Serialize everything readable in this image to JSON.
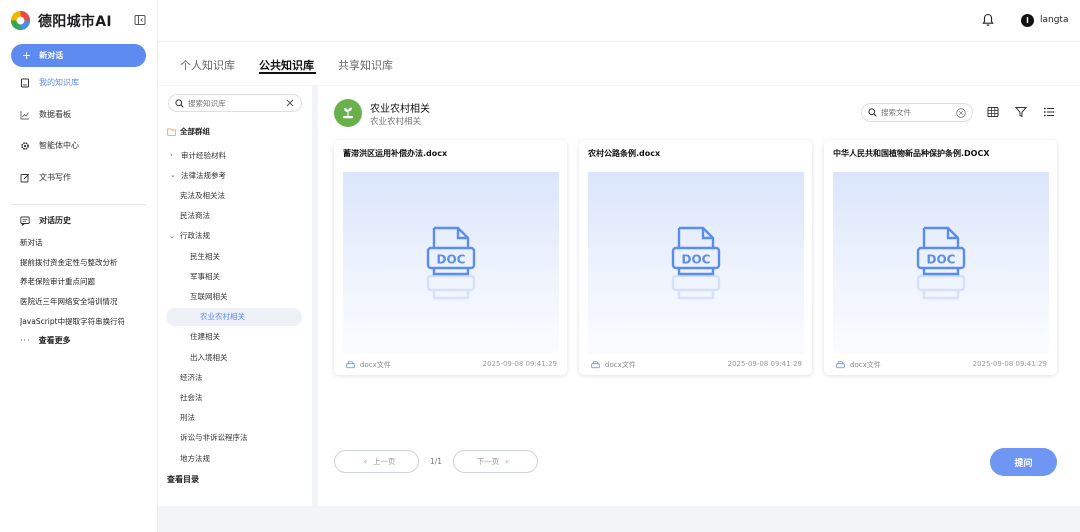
{
  "app": {
    "title": "德阳城市AI"
  },
  "sidebar": {
    "new_chat_label": "新对话",
    "nav": [
      {
        "label": "我的知识库",
        "icon": "book-icon",
        "active": true
      },
      {
        "label": "数据看板",
        "icon": "chart-icon",
        "active": false
      },
      {
        "label": "智能体中心",
        "icon": "gear-icon",
        "active": false
      },
      {
        "label": "文书写作",
        "icon": "edit-icon",
        "active": false
      }
    ],
    "history_title": "对话历史",
    "history": [
      "新对话",
      "提前拨付资金定性与整改分析",
      "养老保险审计重点问题",
      "医院近三年网络安全培训情况",
      "JavaScript中提取字符串换行符"
    ],
    "see_more": "查看更多"
  },
  "topbar": {
    "username": "langta",
    "avatar_initial": "l"
  },
  "tabs": [
    {
      "label": "个人知识库",
      "active": false
    },
    {
      "label": "公共知识库",
      "active": true
    },
    {
      "label": "共享知识库",
      "active": false
    }
  ],
  "tree": {
    "search_placeholder": "搜索知识库",
    "root_label": "全部群组",
    "rows": [
      {
        "label": "审计经验材料",
        "depth": 0,
        "arrow": "›"
      },
      {
        "label": "法律法规参考",
        "depth": 0,
        "arrow": "⌄"
      },
      {
        "label": "宪法及相关法",
        "depth": 1,
        "arrow": ""
      },
      {
        "label": "民法商法",
        "depth": 1,
        "arrow": ""
      },
      {
        "label": "行政法规",
        "depth": 1,
        "arrow": "⌄"
      },
      {
        "label": "民生相关",
        "depth": 2,
        "arrow": ""
      },
      {
        "label": "军事相关",
        "depth": 2,
        "arrow": ""
      },
      {
        "label": "互联网相关",
        "depth": 2,
        "arrow": ""
      },
      {
        "label": "农业农村相关",
        "depth": 2,
        "arrow": "",
        "selected": true
      },
      {
        "label": "住建相关",
        "depth": 2,
        "arrow": ""
      },
      {
        "label": "出入境相关",
        "depth": 2,
        "arrow": ""
      },
      {
        "label": "经济法",
        "depth": 1,
        "arrow": ""
      },
      {
        "label": "社会法",
        "depth": 1,
        "arrow": ""
      },
      {
        "label": "刑法",
        "depth": 1,
        "arrow": ""
      },
      {
        "label": "诉讼与非诉讼程序法",
        "depth": 1,
        "arrow": ""
      },
      {
        "label": "地方法规",
        "depth": 1,
        "arrow": ""
      }
    ],
    "footer": "查看目录"
  },
  "main": {
    "kb_title": "农业农村相关",
    "kb_subtitle": "农业农村相关",
    "file_search_placeholder": "搜索文件",
    "files": [
      {
        "name": "蓄滞洪区运用补偿办法.docx",
        "type": "docx文件",
        "time": "2025-09-08 09:41:29"
      },
      {
        "name": "农村公路条例.docx",
        "type": "docx文件",
        "time": "2025-09-08 09:41:29"
      },
      {
        "name": "中华人民共和国植物新品种保护条例.DOCX",
        "type": "docx文件",
        "time": "2025-09-08 09:41:29"
      }
    ],
    "doc_icon_label": "DOC",
    "pager": {
      "prev": "上一页",
      "next": "下一页",
      "page": "1/1"
    },
    "ask_label": "提问"
  },
  "colors": {
    "accent": "#5e8bf0",
    "ask_button": "#6f96f3",
    "kb_badge": "#6ab04c",
    "selected_row_bg": "#eef1f7"
  }
}
